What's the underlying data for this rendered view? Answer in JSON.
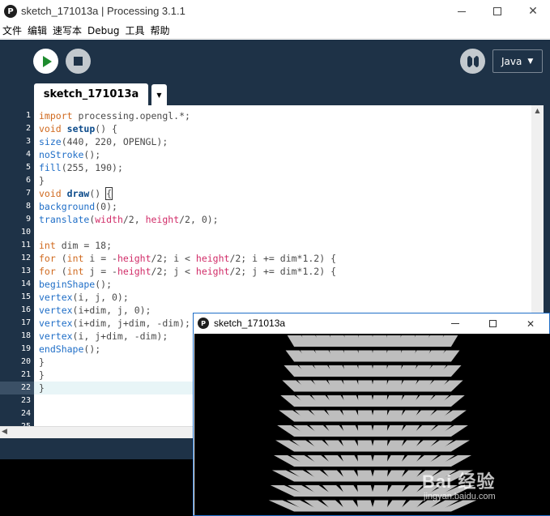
{
  "window": {
    "title": "sketch_171013a | Processing 3.1.1",
    "app_icon": "processing-logo-icon",
    "minimize": "—",
    "maximize": "☐",
    "close": "✕"
  },
  "menu": [
    "文件",
    "编辑",
    "速写本",
    "Debug",
    "工具",
    "帮助"
  ],
  "toolbar": {
    "run_icon": "play-icon",
    "stop_icon": "stop-icon",
    "debug_icon": "debugger-icon",
    "mode_label": "Java",
    "mode_arrow": "▼"
  },
  "tabs": {
    "active_tab": "sketch_171013a",
    "tab_menu_arrow": "▼"
  },
  "editor": {
    "line_numbers": [
      "1",
      "2",
      "3",
      "4",
      "5",
      "6",
      "7",
      "8",
      "9",
      "10",
      "11",
      "12",
      "13",
      "14",
      "15",
      "16",
      "17",
      "18",
      "19",
      "20",
      "21",
      "22",
      "23",
      "24",
      "25"
    ],
    "current_line": 22,
    "lines": [
      [
        [
          "kw",
          "import"
        ],
        [
          "pl",
          " processing.opengl.*;"
        ]
      ],
      [
        [
          "kw",
          "void"
        ],
        [
          "pl",
          " "
        ],
        [
          "fnb",
          "setup"
        ],
        [
          "pl",
          "() {"
        ]
      ],
      [
        [
          "fn",
          "size"
        ],
        [
          "pl",
          "(440, 220, OPENGL);"
        ]
      ],
      [
        [
          "fn",
          "noStroke"
        ],
        [
          "pl",
          "();"
        ]
      ],
      [
        [
          "fn",
          "fill"
        ],
        [
          "pl",
          "(255, 190);"
        ]
      ],
      [
        [
          "pl",
          "}"
        ]
      ],
      [
        [
          "kw",
          "void"
        ],
        [
          "pl",
          " "
        ],
        [
          "fnb",
          "draw"
        ],
        [
          "pl",
          "() "
        ],
        [
          "cur",
          "{"
        ]
      ],
      [
        [
          "fn",
          "background"
        ],
        [
          "pl",
          "(0);"
        ]
      ],
      [
        [
          "fn",
          "translate"
        ],
        [
          "pl",
          "("
        ],
        [
          "var",
          "width"
        ],
        [
          "pl",
          "/2, "
        ],
        [
          "var",
          "height"
        ],
        [
          "pl",
          "/2, 0);"
        ]
      ],
      [
        [
          "pl",
          ""
        ]
      ],
      [
        [
          "kw",
          "int"
        ],
        [
          "pl",
          " dim = 18;"
        ]
      ],
      [
        [
          "kw",
          "for"
        ],
        [
          "pl",
          " ("
        ],
        [
          "kw",
          "int"
        ],
        [
          "pl",
          " i = -"
        ],
        [
          "var",
          "height"
        ],
        [
          "pl",
          "/2; i < "
        ],
        [
          "var",
          "height"
        ],
        [
          "pl",
          "/2; i += dim*1.2) {"
        ]
      ],
      [
        [
          "kw",
          "for"
        ],
        [
          "pl",
          " ("
        ],
        [
          "kw",
          "int"
        ],
        [
          "pl",
          " j = -"
        ],
        [
          "var",
          "height"
        ],
        [
          "pl",
          "/2; j < "
        ],
        [
          "var",
          "height"
        ],
        [
          "pl",
          "/2; j += dim*1.2) {"
        ]
      ],
      [
        [
          "fn",
          "beginShape"
        ],
        [
          "pl",
          "();"
        ]
      ],
      [
        [
          "fn",
          "vertex"
        ],
        [
          "pl",
          "(i, j, 0);"
        ]
      ],
      [
        [
          "fn",
          "vertex"
        ],
        [
          "pl",
          "(i+dim, j, 0);"
        ]
      ],
      [
        [
          "fn",
          "vertex"
        ],
        [
          "pl",
          "(i+dim, j+dim, -dim);"
        ]
      ],
      [
        [
          "fn",
          "vertex"
        ],
        [
          "pl",
          "(i, j+dim, -dim);"
        ]
      ],
      [
        [
          "fn",
          "endShape"
        ],
        [
          "pl",
          "();"
        ]
      ],
      [
        [
          "pl",
          "}"
        ]
      ],
      [
        [
          "pl",
          "}"
        ]
      ],
      [
        [
          "pl",
          "}"
        ]
      ]
    ]
  },
  "sketch_window": {
    "title": "sketch_171013a",
    "minimize": "—",
    "maximize": "☐",
    "close": "✕"
  },
  "watermark": {
    "main": "Bai 经验",
    "sub": "jingyan.baidu.com"
  }
}
